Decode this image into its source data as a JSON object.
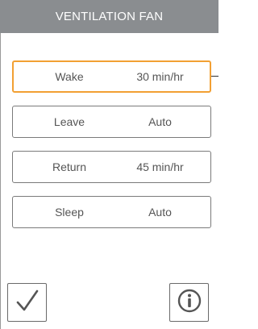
{
  "header": {
    "title": "VENTILATION FAN"
  },
  "schedule": [
    {
      "label": "Wake",
      "value": "30 min/hr",
      "selected": true
    },
    {
      "label": "Leave",
      "value": "Auto",
      "selected": false
    },
    {
      "label": "Return",
      "value": "45 min/hr",
      "selected": false
    },
    {
      "label": "Sleep",
      "value": "Auto",
      "selected": false
    }
  ],
  "buttons": {
    "confirm_icon": "checkmark-icon",
    "info_icon": "info-icon"
  },
  "colors": {
    "header_bg": "#8a8d90",
    "selected_border": "#f2a033",
    "row_border": "#7a7a7a"
  }
}
